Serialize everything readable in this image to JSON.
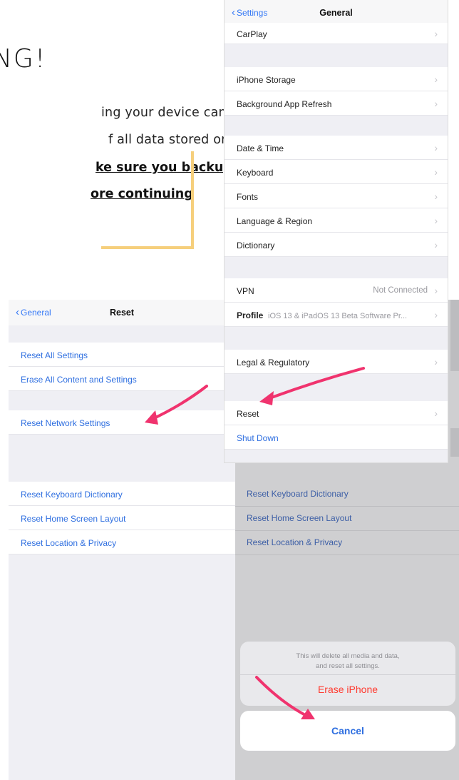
{
  "warning": {
    "title": "NG!",
    "line1": "ing your device can",
    "line2": "f all data stored on",
    "strong1": "ke sure you backup ",
    "strong2": "ore continuing"
  },
  "general": {
    "back": "Settings",
    "title": "General",
    "carplay": "CarPlay",
    "storage": "iPhone Storage",
    "bg_refresh": "Background App Refresh",
    "date_time": "Date & Time",
    "keyboard": "Keyboard",
    "fonts": "Fonts",
    "language": "Language & Region",
    "dictionary": "Dictionary",
    "vpn": "VPN",
    "vpn_status": "Not Connected",
    "profile": "Profile",
    "profile_detail": "iOS 13 & iPadOS 13 Beta Software Pr...",
    "legal": "Legal & Regulatory",
    "reset": "Reset",
    "shutdown": "Shut Down"
  },
  "reset": {
    "back": "General",
    "title": "Reset",
    "all_settings": "Reset All Settings",
    "erase_all": "Erase All Content and Settings",
    "network": "Reset Network Settings",
    "keyboard_dict": "Reset Keyboard Dictionary",
    "home_layout": "Reset Home Screen Layout",
    "location_privacy": "Reset Location & Privacy"
  },
  "dim": {
    "keyboard_dict": "Reset Keyboard Dictionary",
    "home_layout": "Reset Home Screen Layout",
    "location_privacy": "Reset Location & Privacy"
  },
  "sheet": {
    "message_line1": "This will delete all media and data,",
    "message_line2": "and reset all settings.",
    "erase": "Erase iPhone",
    "cancel": "Cancel"
  },
  "colors": {
    "ios_blue": "#2f6fe0",
    "destructive": "#ff3b30",
    "arrow": "#f0336e",
    "accent_frame": "#f6cf7c"
  }
}
